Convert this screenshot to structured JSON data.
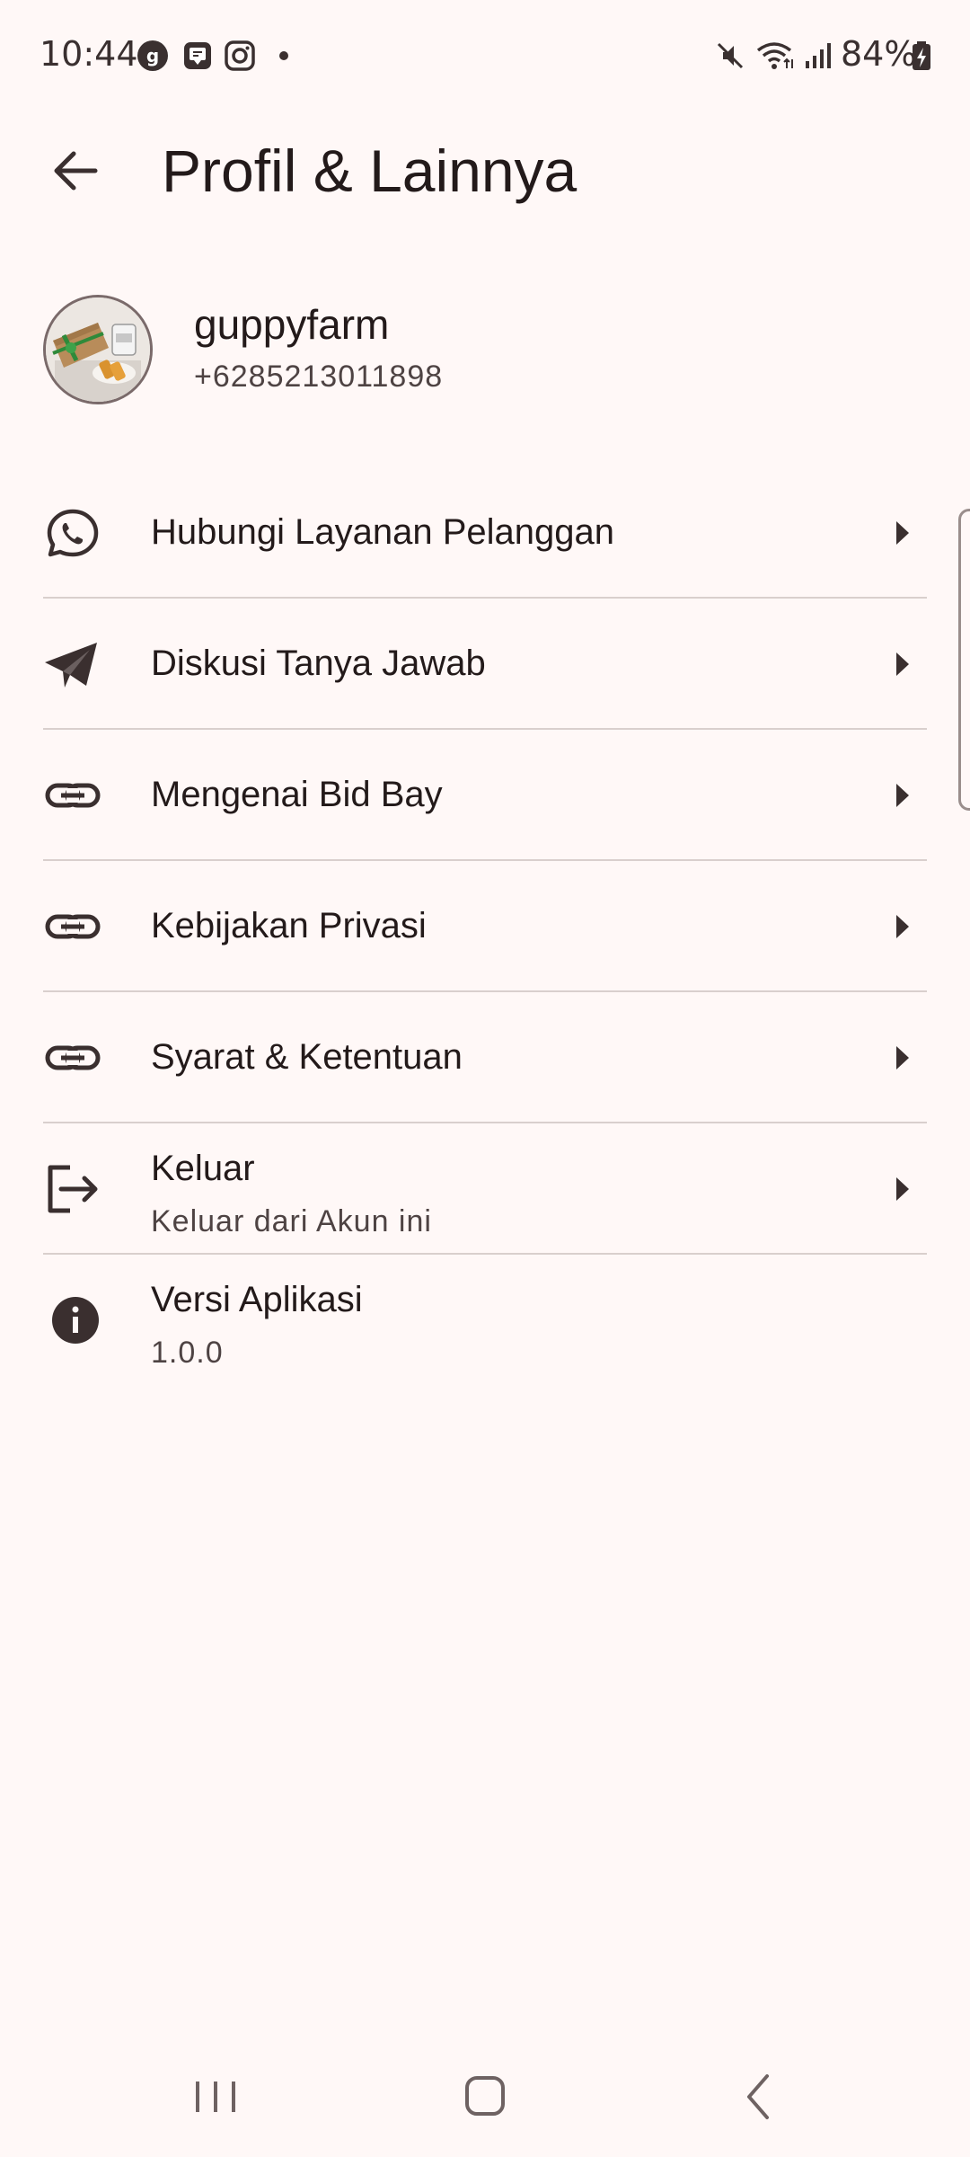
{
  "status_bar": {
    "time": "10:44",
    "battery": "84%"
  },
  "app_bar": {
    "title": "Profil & Lainnya"
  },
  "profile": {
    "username": "guppyfarm",
    "phone": "+6285213011898"
  },
  "menu": [
    {
      "label": "Hubungi Layanan Pelanggan",
      "icon": "whatsapp-icon"
    },
    {
      "label": "Diskusi Tanya Jawab",
      "icon": "telegram-icon"
    },
    {
      "label": "Mengenai Bid Bay",
      "icon": "link-icon"
    },
    {
      "label": "Kebijakan Privasi",
      "icon": "link-icon"
    },
    {
      "label": "Syarat & Ketentuan",
      "icon": "link-icon"
    },
    {
      "label": "Keluar",
      "sub": "Keluar dari Akun ini",
      "icon": "logout-icon"
    },
    {
      "label": "Versi Aplikasi",
      "sub": "1.0.0",
      "icon": "info-icon"
    }
  ],
  "colors": {
    "background": "#fff8f7",
    "text": "#231a1a",
    "divider": "#d9cfcd"
  }
}
